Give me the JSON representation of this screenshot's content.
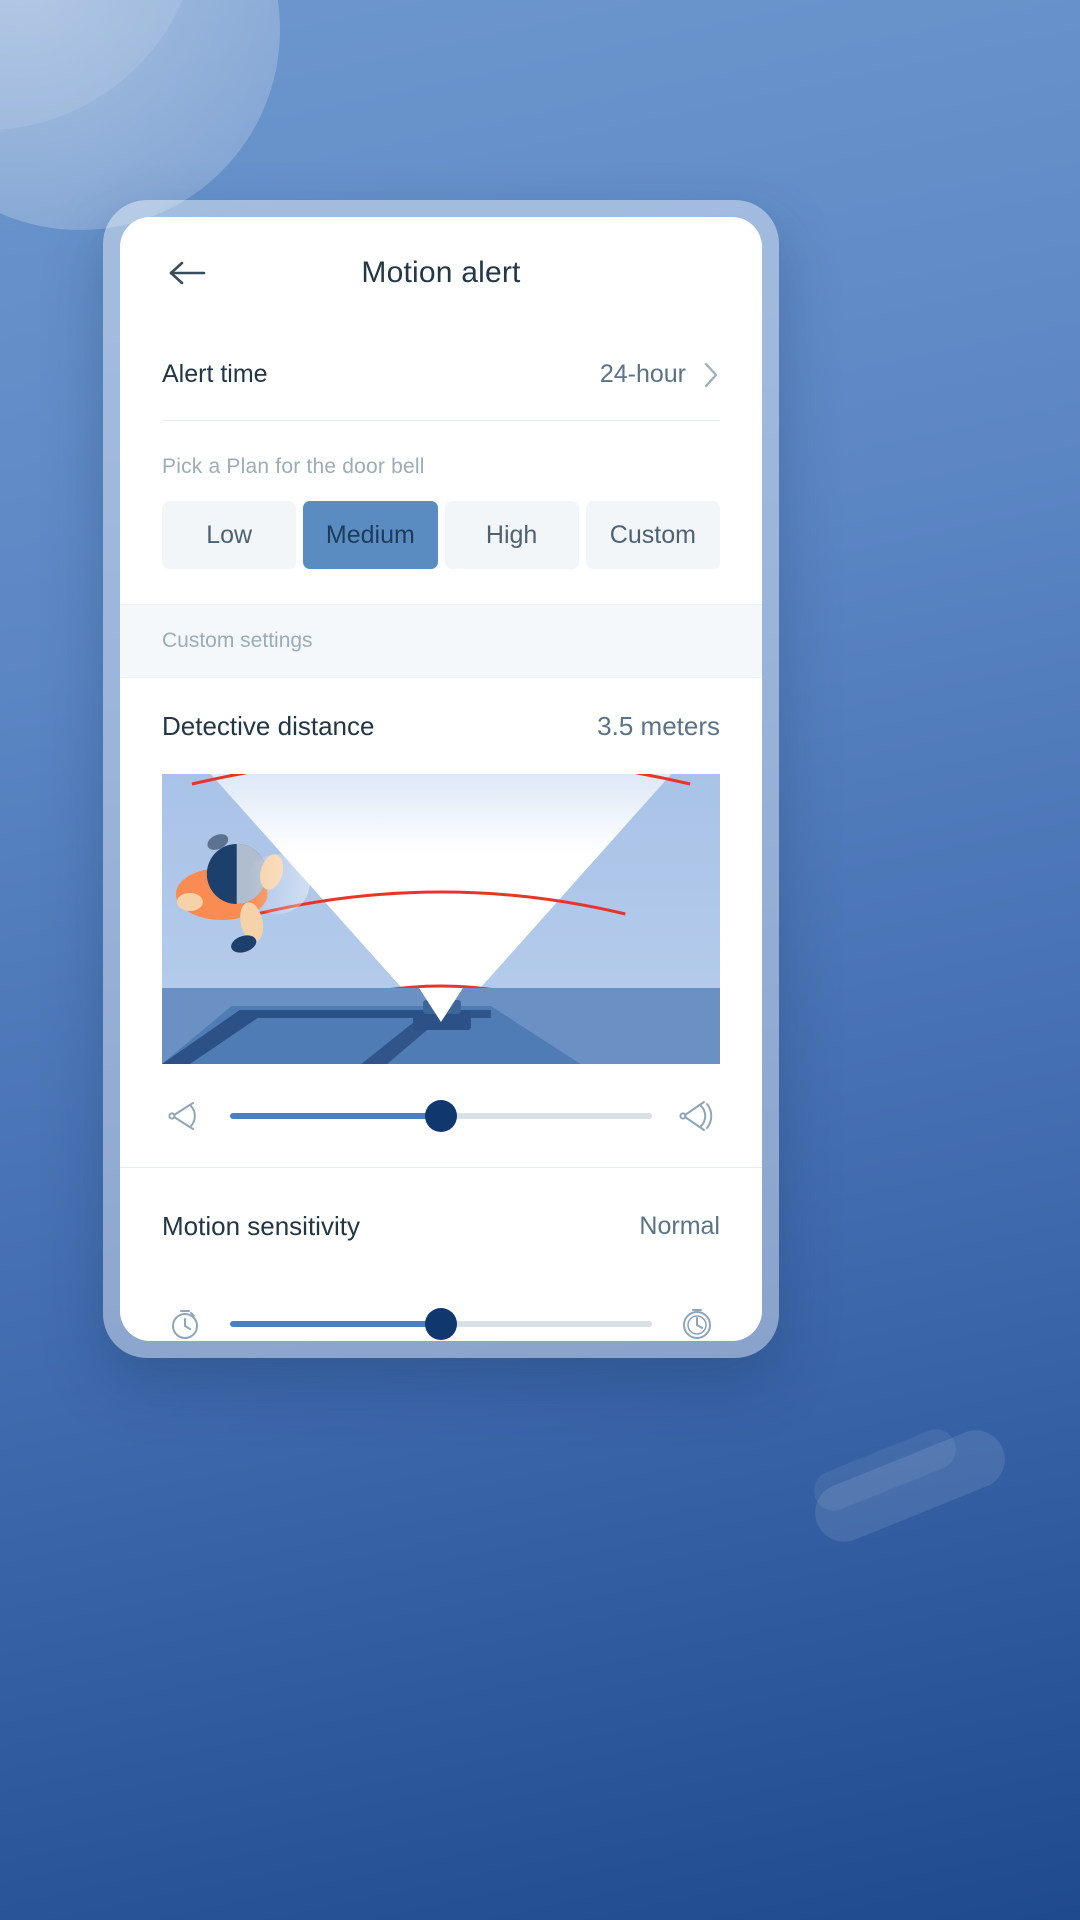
{
  "header": {
    "title": "Motion alert",
    "back_icon": "arrow-left-icon"
  },
  "alert_time": {
    "label": "Alert time",
    "value": "24-hour",
    "chevron_icon": "chevron-right-icon"
  },
  "plan": {
    "hint": "Pick a Plan for the door bell",
    "options": [
      {
        "label": "Low",
        "selected": false
      },
      {
        "label": "Medium",
        "selected": true
      },
      {
        "label": "High",
        "selected": false
      },
      {
        "label": "Custom",
        "selected": false
      }
    ],
    "selected": "Medium",
    "selected_bg": "#5a8cc2",
    "option_bg": "#f3f6f8"
  },
  "custom_section": {
    "band_label": "Custom settings"
  },
  "distance": {
    "label": "Detective distance",
    "value": "3.5 meters",
    "slider": {
      "percent": 50,
      "left_icon": "narrow-angle-detection-icon",
      "right_icon": "wide-angle-detection-icon",
      "fill_color": "#4a7fc1",
      "thumb_color": "#10386f",
      "track_color": "#d7e0e4"
    },
    "illustration": {
      "name": "detection-cone-illustration",
      "sky_color": "#aec6e8",
      "cone_color": "#ffffff",
      "arc_color": "#e8342a",
      "ground_color": "#4f7cb4",
      "arc_count": 3,
      "person": {
        "shirt_color": "#f98b53",
        "hair_color": "#1d3f6b",
        "skin_color": "#f6d2a8",
        "shoe_color": "#1d3f6b"
      }
    }
  },
  "sensitivity": {
    "label": "Motion sensitivity",
    "value": "Normal",
    "slider": {
      "percent": 50,
      "left_icon": "stopwatch-low-icon",
      "right_icon": "stopwatch-high-icon",
      "fill_color": "#4a7fc1",
      "thumb_color": "#10386f",
      "track_color": "#d7e0e4"
    }
  },
  "background": {
    "gradient_from": "#6d97cd",
    "gradient_to": "#1f4a8e"
  }
}
